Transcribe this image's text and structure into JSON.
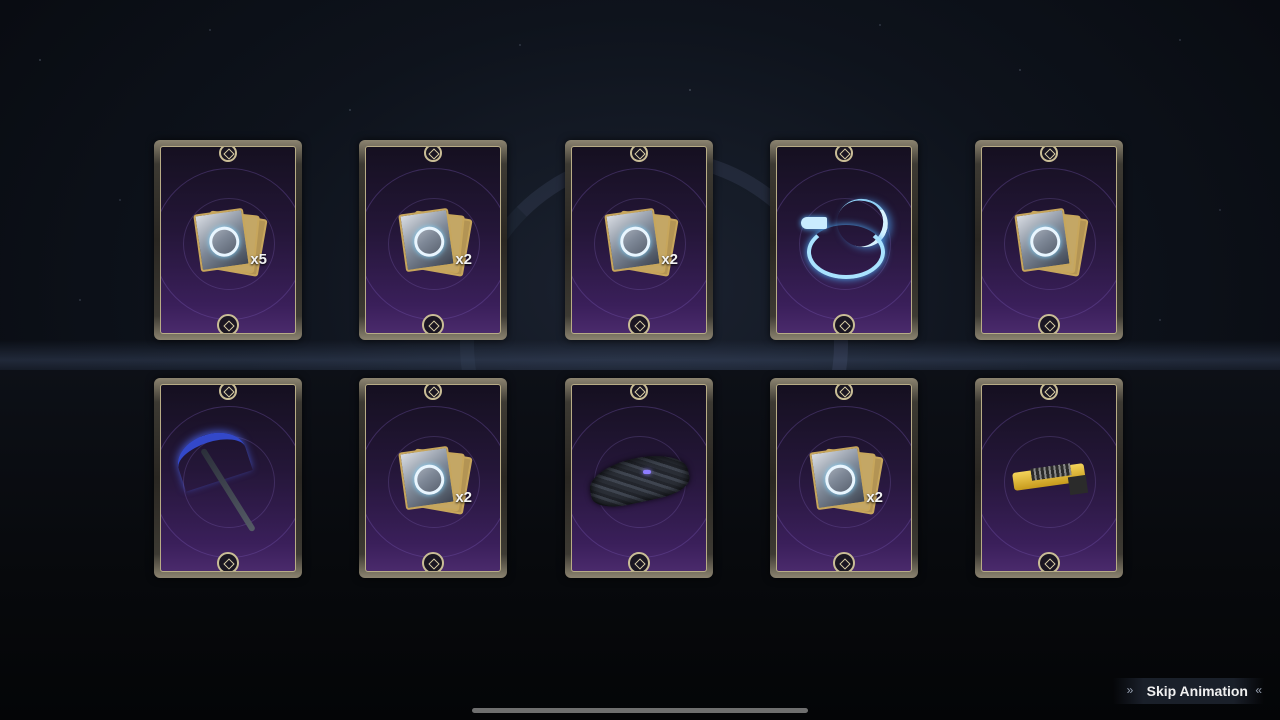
{
  "rewards": {
    "row1": [
      {
        "item": "trading-card-pack",
        "quantity": "x5"
      },
      {
        "item": "trading-card-pack",
        "quantity": "x2"
      },
      {
        "item": "trading-card-pack",
        "quantity": "x2"
      },
      {
        "item": "ice-dragon-ornament",
        "quantity": ""
      },
      {
        "item": "trading-card-pack",
        "quantity": ""
      }
    ],
    "row2": [
      {
        "item": "scythe",
        "quantity": ""
      },
      {
        "item": "trading-card-pack",
        "quantity": "x2"
      },
      {
        "item": "glider-skin",
        "quantity": ""
      },
      {
        "item": "trading-card-pack",
        "quantity": "x2"
      },
      {
        "item": "gun-attachment",
        "quantity": ""
      }
    ]
  },
  "controls": {
    "skip_label": "Skip Animation",
    "skip_icon_left": "chevrons-right-icon",
    "skip_icon_right": "chevrons-left-icon"
  },
  "colors": {
    "card_frame": "#b8ac86",
    "card_inner_top": "#151020",
    "card_inner_bottom": "#4a2a6c"
  }
}
